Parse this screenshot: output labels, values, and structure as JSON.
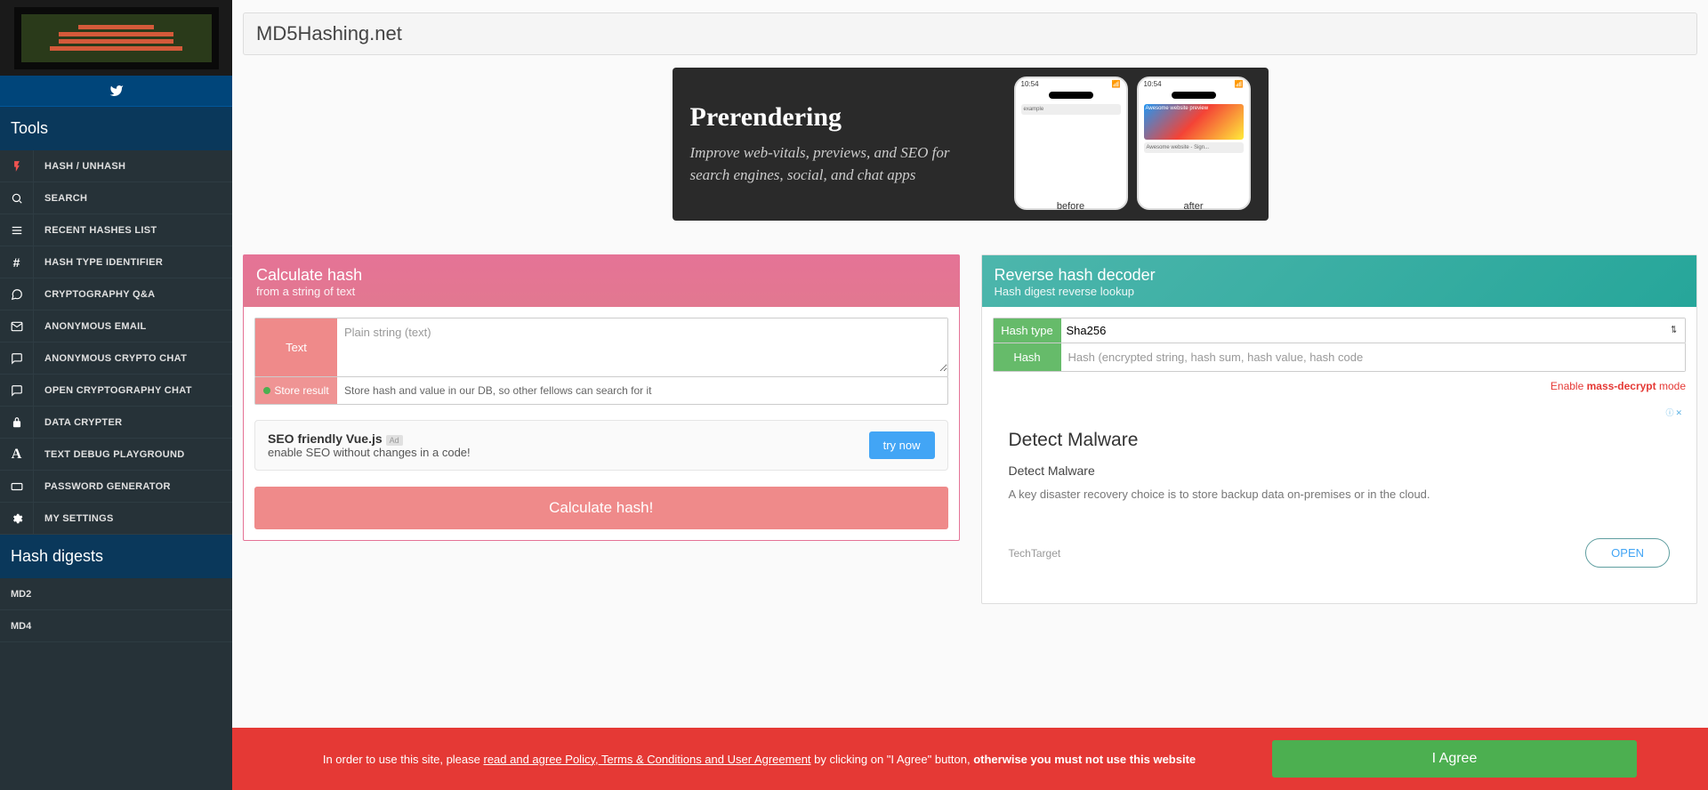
{
  "sidebar": {
    "tools_title": "Tools",
    "hash_digests_title": "Hash digests",
    "items": [
      {
        "icon": "bolt",
        "label": "HASH / UNHASH"
      },
      {
        "icon": "search",
        "label": "SEARCH"
      },
      {
        "icon": "list",
        "label": "RECENT HASHES LIST"
      },
      {
        "icon": "hash",
        "label": "HASH TYPE IDENTIFIER"
      },
      {
        "icon": "chat",
        "label": "CRYPTOGRAPHY Q&A"
      },
      {
        "icon": "mail",
        "label": "ANONYMOUS EMAIL"
      },
      {
        "icon": "comment",
        "label": "ANONYMOUS CRYPTO CHAT"
      },
      {
        "icon": "comment",
        "label": "OPEN CRYPTOGRAPHY CHAT"
      },
      {
        "icon": "lock",
        "label": "DATA CRYPTER"
      },
      {
        "icon": "font",
        "label": "TEXT DEBUG PLAYGROUND"
      },
      {
        "icon": "card",
        "label": "PASSWORD GENERATOR"
      },
      {
        "icon": "gear",
        "label": "MY SETTINGS"
      }
    ],
    "hash_items": [
      "MD2",
      "MD4"
    ]
  },
  "page": {
    "title": "MD5Hashing.net"
  },
  "top_ad": {
    "title": "Prerendering",
    "desc": "Improve web-vitals, previews, and SEO for search engines, social, and chat apps",
    "before": "before",
    "after": "after"
  },
  "calc": {
    "title": "Calculate hash",
    "subtitle": "from a string of text",
    "text_label": "Text",
    "text_placeholder": "Plain string (text)",
    "store_label": "Store result",
    "store_desc": "Store hash and value in our DB, so other fellows can search for it",
    "button": "Calculate hash!"
  },
  "seo": {
    "title": "SEO friendly Vue.js",
    "badge": "Ad",
    "desc": "enable SEO without changes in a code!",
    "try": "try now"
  },
  "decoder": {
    "title": "Reverse hash decoder",
    "subtitle": "Hash digest reverse lookup",
    "type_label": "Hash type",
    "type_value": "Sha256",
    "hash_label": "Hash",
    "hash_placeholder": "Hash (encrypted string, hash sum, hash value, hash code",
    "enable": "Enable ",
    "mass": "mass-decrypt",
    "mode": " mode"
  },
  "side_ad": {
    "marker": "ⓘ ✕",
    "title": "Detect Malware",
    "subtitle": "Detect Malware",
    "desc": "A key disaster recovery choice is to store backup data on-premises or in the cloud.",
    "advertiser": "TechTarget",
    "open": "OPEN"
  },
  "cookie": {
    "prefix": "In order to use this site, please ",
    "link": "read and agree Policy, Terms & Conditions and User Agreement",
    "mid": " by clicking on \"I Agree\" button, ",
    "bold": "otherwise you must not use this website",
    "agree": "I Agree"
  },
  "icons": {
    "bolt": "⚡",
    "search": "🔍",
    "list": "☰",
    "hash": "#",
    "chat": "💬",
    "mail": "✉",
    "comment": "💬",
    "lock": "🔒",
    "font": "A",
    "card": "▭",
    "gear": "⚙"
  }
}
